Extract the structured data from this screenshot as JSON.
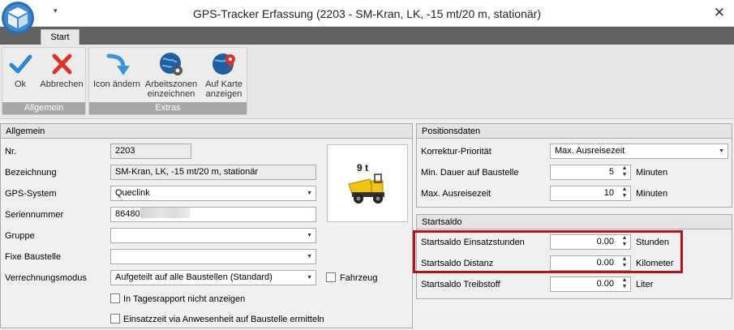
{
  "window": {
    "title": "GPS-Tracker Erfassung (2203 - SM-Kran, LK, -15 mt/20 m, stationär)",
    "close_glyph": "✕",
    "qat_glyph": "▾"
  },
  "tabs": [
    {
      "label": "Start"
    }
  ],
  "ribbon": {
    "groups": [
      {
        "label": "Allgemein",
        "buttons": [
          {
            "label": "Ok",
            "icon": "checkmark-icon"
          },
          {
            "label": "Abbrechen",
            "icon": "x-icon"
          }
        ]
      },
      {
        "label": "Extras",
        "buttons": [
          {
            "label": "Icon ändern",
            "icon": "arrow-curve-icon"
          },
          {
            "label": "Arbeitszonen einzeichnen",
            "icon": "globe-gear-icon"
          },
          {
            "label": "Auf Karte anzeigen",
            "icon": "globe-pin-icon"
          }
        ]
      }
    ]
  },
  "allgemein": {
    "header": "Allgemein",
    "nr": {
      "label": "Nr.",
      "value": "2203"
    },
    "bezeichnung": {
      "label": "Bezeichnung",
      "value": "SM-Kran, LK, -15 mt/20 m, stationär"
    },
    "gps_system": {
      "label": "GPS-System",
      "value": "Queclink"
    },
    "seriennummer": {
      "label": "Seriennummer",
      "value": "86480"
    },
    "gruppe": {
      "label": "Gruppe",
      "value": ""
    },
    "fixe_baustelle": {
      "label": "Fixe Baustelle",
      "value": ""
    },
    "verrechnungsmodus": {
      "label": "Verrechnungsmodus",
      "value": "Aufgeteilt auf alle Baustellen (Standard)"
    },
    "fahrzeug": {
      "label": "Fahrzeug",
      "checked": false
    },
    "tagesrapport": {
      "label": "In Tagesrapport nicht anzeigen",
      "checked": false
    },
    "einsatzzeit": {
      "label": "Einsatzzeit via Anwesenheit auf Baustelle ermitteln",
      "checked": false
    },
    "vehicle_image": {
      "caption": "9 t",
      "icon": "dumper-vehicle-icon"
    }
  },
  "positionsdaten": {
    "header": "Positionsdaten",
    "korrektur": {
      "label": "Korrektur-Priorität",
      "value": "Max. Ausreisezeit"
    },
    "min_dauer": {
      "label": "Min. Dauer auf Baustelle",
      "value": "5",
      "unit": "Minuten"
    },
    "max_ausreise": {
      "label": "Max. Ausreisezeit",
      "value": "10",
      "unit": "Minuten"
    }
  },
  "startsaldo": {
    "header": "Startsaldo",
    "einsatzstunden": {
      "label": "Startsaldo Einsatzstunden",
      "value": "0.00",
      "unit": "Stunden"
    },
    "distanz": {
      "label": "Startsaldo Distanz",
      "value": "0.00",
      "unit": "Kilometer"
    },
    "treibstoff": {
      "label": "Startsaldo Treibstoff",
      "value": "0.00",
      "unit": "Liter"
    }
  },
  "colors": {
    "highlight": "#b3131f",
    "tabbar": "#626262",
    "ribbon_group_label": "#a7a7a7",
    "ok_blue": "#2f86c9",
    "cancel_red": "#d9342b"
  },
  "glyphs": {
    "combo_arrow": "▼",
    "spin_up": "▲",
    "spin_down": "▼"
  }
}
